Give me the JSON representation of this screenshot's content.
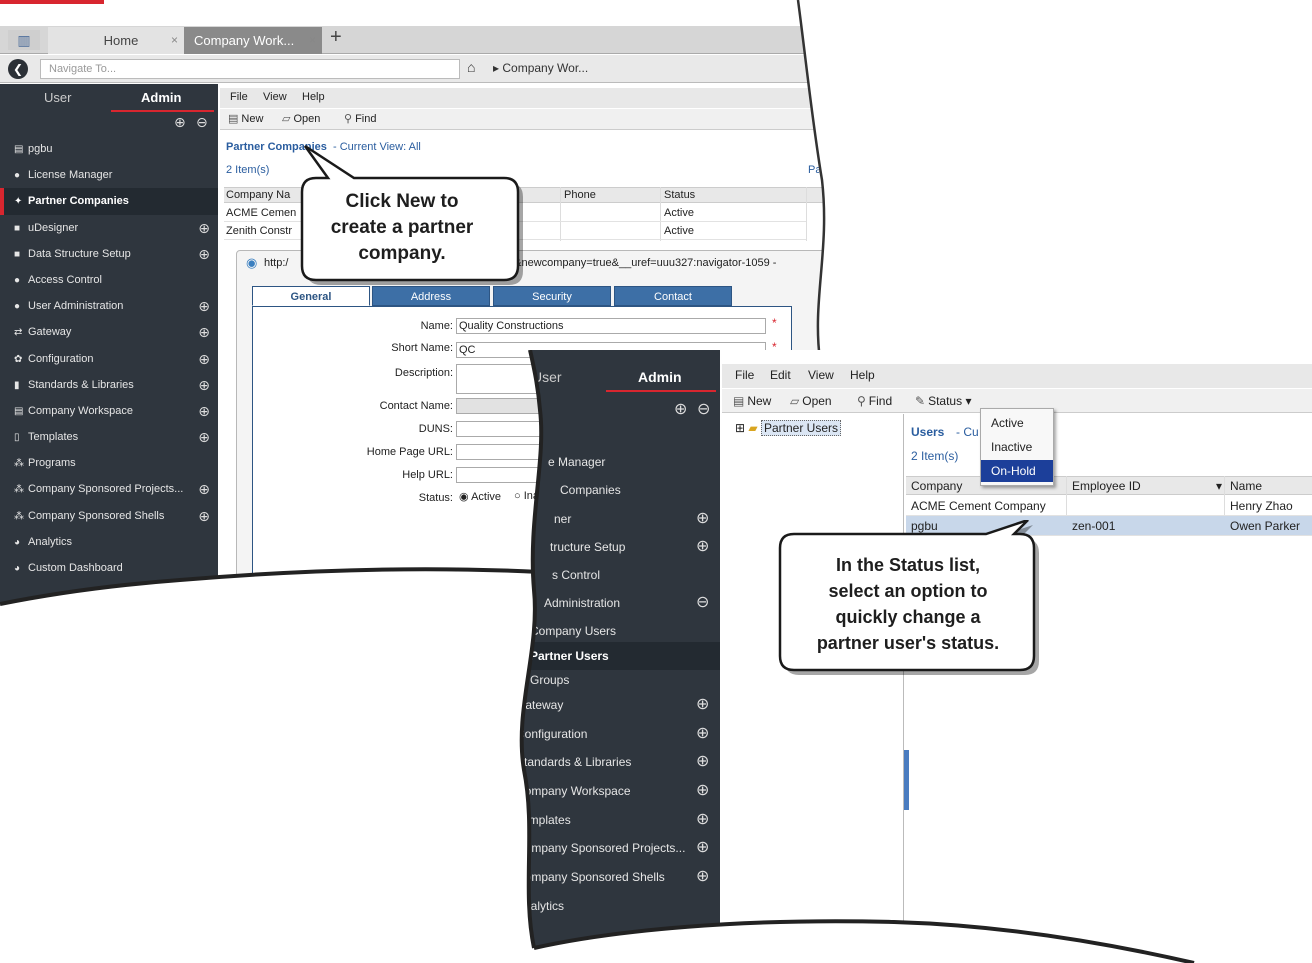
{
  "shot1": {
    "app_icon": "bar-chart-icon",
    "tabs": [
      {
        "label": "Home",
        "close": "×"
      },
      {
        "label": "Company Work...",
        "close": "×"
      }
    ],
    "new_tab": "+",
    "navigate_placeholder": "Navigate To...",
    "breadcrumb": "Company Wor...",
    "sidebar": {
      "tab_user": "User",
      "tab_admin": "Admin",
      "expand": "⊕",
      "collapse": "⊖",
      "items": [
        {
          "label": "pgbu",
          "icon": "workspace-icon"
        },
        {
          "label": "License Manager",
          "icon": "users-icon"
        },
        {
          "label": "Partner Companies",
          "icon": "handshake-icon"
        },
        {
          "label": "uDesigner",
          "icon": "folder-icon"
        },
        {
          "label": "Data Structure Setup",
          "icon": "folder-icon"
        },
        {
          "label": "Access Control",
          "icon": "users-icon"
        },
        {
          "label": "User Administration",
          "icon": "users-icon"
        },
        {
          "label": "Gateway",
          "icon": "gateway-icon"
        },
        {
          "label": "Configuration",
          "icon": "gear-icon"
        },
        {
          "label": "Standards & Libraries",
          "icon": "book-icon"
        },
        {
          "label": "Company Workspace",
          "icon": "workspace-icon"
        },
        {
          "label": "Templates",
          "icon": "document-icon"
        },
        {
          "label": "Programs",
          "icon": "hierarchy-icon"
        },
        {
          "label": "Company Sponsored Projects...",
          "icon": "hierarchy-icon"
        },
        {
          "label": "Company Sponsored Shells",
          "icon": "hierarchy-icon"
        },
        {
          "label": "Analytics",
          "icon": "chart-icon"
        },
        {
          "label": "Custom Dashboard",
          "icon": "dashboard-icon"
        }
      ]
    },
    "menu": [
      "File",
      "View",
      "Help"
    ],
    "toolbar": {
      "new": "New",
      "open": "Open",
      "find": "Find"
    },
    "list_title": "Partner Companies",
    "list_view": "- Current View:  All",
    "item_count": "2  Item(s)",
    "pa_fragment": "Pa",
    "columns": [
      "Company Na",
      "Phone",
      "Status"
    ],
    "rows": [
      {
        "company": "ACME Cemen",
        "status": "Active"
      },
      {
        "company": "Zenith Constr",
        "status": "Active"
      }
    ],
    "dialog": {
      "url_start": "http:/",
      "url_end": "0&newcompany=true&__uref=uuu327:navigator-1059 -",
      "tabs": [
        "General",
        "Address",
        "Security",
        "Contact"
      ],
      "fields": [
        {
          "label": "Name:",
          "value": "Quality Constructions"
        },
        {
          "label": "Short Name:",
          "value": "QC"
        },
        {
          "label": "Description:",
          "value": ""
        },
        {
          "label": "Contact Name:",
          "value": ""
        },
        {
          "label": "DUNS:",
          "value": ""
        },
        {
          "label": "Home Page URL:",
          "value": ""
        },
        {
          "label": "Help URL:",
          "value": ""
        }
      ],
      "status_label": "Status:",
      "status_active": "Active",
      "status_inactive": "Ina"
    }
  },
  "shot2": {
    "sidebar": {
      "tab_user": "User",
      "tab_admin": "Admin",
      "expand": "⊕",
      "collapse": "⊖",
      "items": [
        {
          "label": "e Manager"
        },
        {
          "label": "Companies"
        },
        {
          "label": "ner"
        },
        {
          "label": "tructure Setup"
        },
        {
          "label": "s Control"
        },
        {
          "label": "Administration"
        },
        {
          "label": "Company Users"
        },
        {
          "label": "Partner Users"
        },
        {
          "label": "Groups"
        },
        {
          "label": "Gateway"
        },
        {
          "label": "Configuration"
        },
        {
          "label": "Standards & Libraries"
        },
        {
          "label": "Company Workspace"
        },
        {
          "label": "Templates"
        },
        {
          "label": "Company Sponsored Projects..."
        },
        {
          "label": "Company Sponsored Shells"
        },
        {
          "label": "Analytics"
        }
      ]
    },
    "menu": [
      "File",
      "Edit",
      "View",
      "Help"
    ],
    "toolbar": {
      "new": "New",
      "open": "Open",
      "find": "Find",
      "status": "Status"
    },
    "tree_node": "Partner Users",
    "list_title": "Users",
    "list_view": "- Cu",
    "item_count": "2  Item(s)",
    "columns": [
      "Company",
      "Employee ID",
      "Name"
    ],
    "rows": [
      {
        "company": "ACME Cement Company",
        "employee_id": "",
        "name": "Henry Zhao"
      },
      {
        "company": "pgbu",
        "employee_id": "zen-001",
        "name": "Owen Parker"
      }
    ],
    "status_options": [
      "Active",
      "Inactive",
      "On-Hold"
    ]
  },
  "callouts": {
    "first": [
      "Click New to",
      "create a partner",
      "company."
    ],
    "second": [
      "In the Status list,",
      "select an option to",
      "quickly change a",
      "partner user's status."
    ]
  }
}
